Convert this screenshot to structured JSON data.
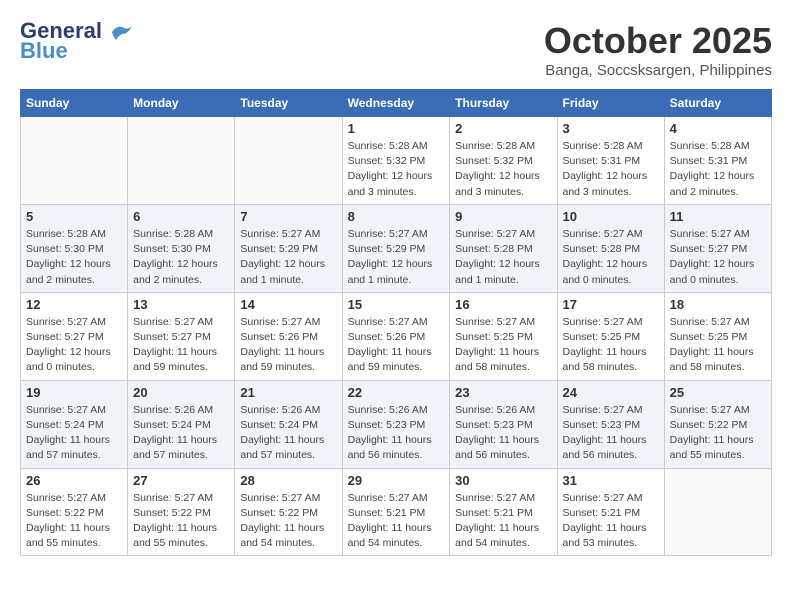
{
  "header": {
    "logo_general": "General",
    "logo_blue": "Blue",
    "month": "October 2025",
    "location": "Banga, Soccsksargen, Philippines"
  },
  "weekdays": [
    "Sunday",
    "Monday",
    "Tuesday",
    "Wednesday",
    "Thursday",
    "Friday",
    "Saturday"
  ],
  "weeks": [
    [
      {
        "day": "",
        "info": ""
      },
      {
        "day": "",
        "info": ""
      },
      {
        "day": "",
        "info": ""
      },
      {
        "day": "1",
        "info": "Sunrise: 5:28 AM\nSunset: 5:32 PM\nDaylight: 12 hours\nand 3 minutes."
      },
      {
        "day": "2",
        "info": "Sunrise: 5:28 AM\nSunset: 5:32 PM\nDaylight: 12 hours\nand 3 minutes."
      },
      {
        "day": "3",
        "info": "Sunrise: 5:28 AM\nSunset: 5:31 PM\nDaylight: 12 hours\nand 3 minutes."
      },
      {
        "day": "4",
        "info": "Sunrise: 5:28 AM\nSunset: 5:31 PM\nDaylight: 12 hours\nand 2 minutes."
      }
    ],
    [
      {
        "day": "5",
        "info": "Sunrise: 5:28 AM\nSunset: 5:30 PM\nDaylight: 12 hours\nand 2 minutes."
      },
      {
        "day": "6",
        "info": "Sunrise: 5:28 AM\nSunset: 5:30 PM\nDaylight: 12 hours\nand 2 minutes."
      },
      {
        "day": "7",
        "info": "Sunrise: 5:27 AM\nSunset: 5:29 PM\nDaylight: 12 hours\nand 1 minute."
      },
      {
        "day": "8",
        "info": "Sunrise: 5:27 AM\nSunset: 5:29 PM\nDaylight: 12 hours\nand 1 minute."
      },
      {
        "day": "9",
        "info": "Sunrise: 5:27 AM\nSunset: 5:28 PM\nDaylight: 12 hours\nand 1 minute."
      },
      {
        "day": "10",
        "info": "Sunrise: 5:27 AM\nSunset: 5:28 PM\nDaylight: 12 hours\nand 0 minutes."
      },
      {
        "day": "11",
        "info": "Sunrise: 5:27 AM\nSunset: 5:27 PM\nDaylight: 12 hours\nand 0 minutes."
      }
    ],
    [
      {
        "day": "12",
        "info": "Sunrise: 5:27 AM\nSunset: 5:27 PM\nDaylight: 12 hours\nand 0 minutes."
      },
      {
        "day": "13",
        "info": "Sunrise: 5:27 AM\nSunset: 5:27 PM\nDaylight: 11 hours\nand 59 minutes."
      },
      {
        "day": "14",
        "info": "Sunrise: 5:27 AM\nSunset: 5:26 PM\nDaylight: 11 hours\nand 59 minutes."
      },
      {
        "day": "15",
        "info": "Sunrise: 5:27 AM\nSunset: 5:26 PM\nDaylight: 11 hours\nand 59 minutes."
      },
      {
        "day": "16",
        "info": "Sunrise: 5:27 AM\nSunset: 5:25 PM\nDaylight: 11 hours\nand 58 minutes."
      },
      {
        "day": "17",
        "info": "Sunrise: 5:27 AM\nSunset: 5:25 PM\nDaylight: 11 hours\nand 58 minutes."
      },
      {
        "day": "18",
        "info": "Sunrise: 5:27 AM\nSunset: 5:25 PM\nDaylight: 11 hours\nand 58 minutes."
      }
    ],
    [
      {
        "day": "19",
        "info": "Sunrise: 5:27 AM\nSunset: 5:24 PM\nDaylight: 11 hours\nand 57 minutes."
      },
      {
        "day": "20",
        "info": "Sunrise: 5:26 AM\nSunset: 5:24 PM\nDaylight: 11 hours\nand 57 minutes."
      },
      {
        "day": "21",
        "info": "Sunrise: 5:26 AM\nSunset: 5:24 PM\nDaylight: 11 hours\nand 57 minutes."
      },
      {
        "day": "22",
        "info": "Sunrise: 5:26 AM\nSunset: 5:23 PM\nDaylight: 11 hours\nand 56 minutes."
      },
      {
        "day": "23",
        "info": "Sunrise: 5:26 AM\nSunset: 5:23 PM\nDaylight: 11 hours\nand 56 minutes."
      },
      {
        "day": "24",
        "info": "Sunrise: 5:27 AM\nSunset: 5:23 PM\nDaylight: 11 hours\nand 56 minutes."
      },
      {
        "day": "25",
        "info": "Sunrise: 5:27 AM\nSunset: 5:22 PM\nDaylight: 11 hours\nand 55 minutes."
      }
    ],
    [
      {
        "day": "26",
        "info": "Sunrise: 5:27 AM\nSunset: 5:22 PM\nDaylight: 11 hours\nand 55 minutes."
      },
      {
        "day": "27",
        "info": "Sunrise: 5:27 AM\nSunset: 5:22 PM\nDaylight: 11 hours\nand 55 minutes."
      },
      {
        "day": "28",
        "info": "Sunrise: 5:27 AM\nSunset: 5:22 PM\nDaylight: 11 hours\nand 54 minutes."
      },
      {
        "day": "29",
        "info": "Sunrise: 5:27 AM\nSunset: 5:21 PM\nDaylight: 11 hours\nand 54 minutes."
      },
      {
        "day": "30",
        "info": "Sunrise: 5:27 AM\nSunset: 5:21 PM\nDaylight: 11 hours\nand 54 minutes."
      },
      {
        "day": "31",
        "info": "Sunrise: 5:27 AM\nSunset: 5:21 PM\nDaylight: 11 hours\nand 53 minutes."
      },
      {
        "day": "",
        "info": ""
      }
    ]
  ]
}
